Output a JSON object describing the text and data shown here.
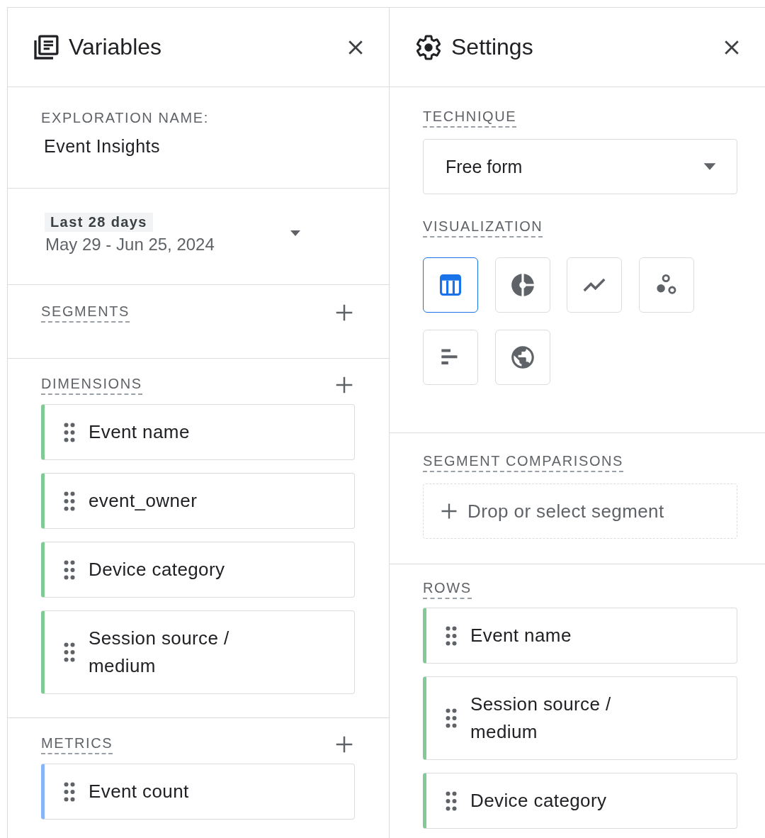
{
  "variables_panel": {
    "title": "Variables",
    "exploration_name": {
      "label": "EXPLORATION NAME:",
      "value": "Event Insights"
    },
    "date_range": {
      "preset": "Last 28 days",
      "range": "May 29 - Jun 25, 2024"
    },
    "segments": {
      "label": "SEGMENTS"
    },
    "dimensions": {
      "label": "DIMENSIONS",
      "items": [
        {
          "name": "Event name",
          "color": "#81c995"
        },
        {
          "name": "event_owner",
          "color": "#81c995"
        },
        {
          "name": "Device category",
          "color": "#81c995"
        },
        {
          "name": "Session source / medium",
          "color": "#81c995"
        }
      ]
    },
    "metrics": {
      "label": "METRICS",
      "items": [
        {
          "name": "Event count",
          "color": "#8ab4f8"
        }
      ]
    }
  },
  "settings_panel": {
    "title": "Settings",
    "technique": {
      "label": "TECHNIQUE",
      "value": "Free form"
    },
    "visualization": {
      "label": "VISUALIZATION",
      "options": [
        {
          "kind": "table",
          "selected": true
        },
        {
          "kind": "donut",
          "selected": false
        },
        {
          "kind": "line",
          "selected": false
        },
        {
          "kind": "scatter",
          "selected": false
        },
        {
          "kind": "bar",
          "selected": false
        },
        {
          "kind": "geo",
          "selected": false
        }
      ]
    },
    "segment_comparisons": {
      "label": "SEGMENT COMPARISONS",
      "prompt": "Drop or select segment"
    },
    "rows": {
      "label": "ROWS",
      "items": [
        {
          "name": "Event name",
          "color": "#81c995"
        },
        {
          "name": "Session source / medium",
          "color": "#81c995"
        },
        {
          "name": "Device category",
          "color": "#81c995"
        }
      ]
    }
  }
}
